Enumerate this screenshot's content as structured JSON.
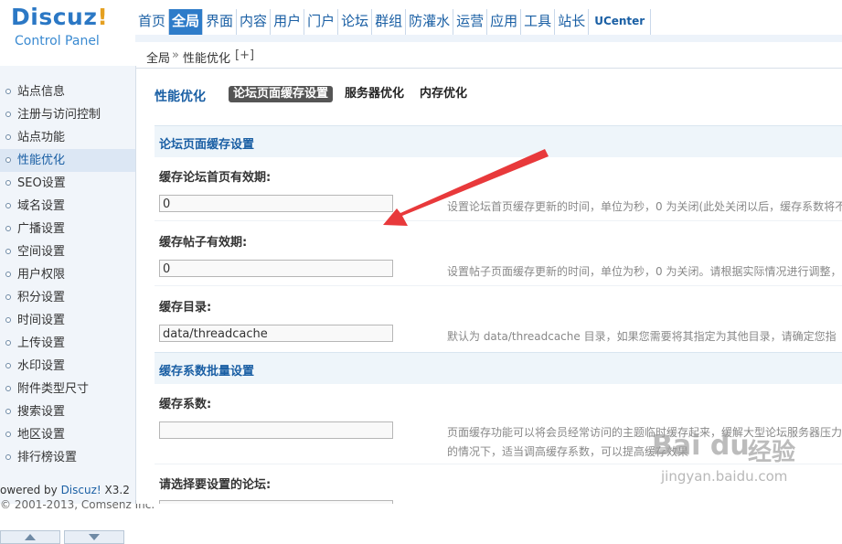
{
  "logo": {
    "brand": "Discuz",
    "brand_exclaim": "!",
    "sub": "Control Panel"
  },
  "topnav": {
    "items": [
      "首页",
      "全局",
      "界面",
      "内容",
      "用户",
      "门户",
      "论坛",
      "群组",
      "防灌水",
      "运营",
      "应用",
      "工具",
      "站长",
      "UCenter"
    ],
    "active": "全局"
  },
  "breadcrumb": {
    "root": "全局",
    "sep": "»",
    "current": "性能优化",
    "add": "[+]"
  },
  "sidebar": {
    "items": [
      "站点信息",
      "注册与访问控制",
      "站点功能",
      "性能优化",
      "SEO设置",
      "域名设置",
      "广播设置",
      "空间设置",
      "用户权限",
      "积分设置",
      "时间设置",
      "上传设置",
      "水印设置",
      "附件类型尺寸",
      "搜索设置",
      "地区设置",
      "排行榜设置"
    ],
    "active": "性能优化"
  },
  "footer": {
    "powered_prefix": "owered by ",
    "powered_brand": "Discuz!",
    "version": " X3.2",
    "copyright": "© 2001-2013, Comsenz Inc."
  },
  "main": {
    "title": "性能优化",
    "tabs": [
      "论坛页面缓存设置",
      "服务器优化",
      "内存优化"
    ],
    "active_tab": "论坛页面缓存设置",
    "section1": "论坛页面缓存设置",
    "fields": [
      {
        "label": "缓存论坛首页有效期:",
        "value": "0",
        "desc": "设置论坛首页缓存更新的时间，单位为秒，0 为关闭(此处关闭以后，缓存系数将不"
      },
      {
        "label": "缓存帖子有效期:",
        "value": "0",
        "desc": "设置帖子页面缓存更新的时间，单位为秒，0 为关闭。请根据实际情况进行调整，"
      },
      {
        "label": "缓存目录:",
        "value": "data/threadcache",
        "desc": "默认为 data/threadcache 目录，如果您需要将其指定为其他目录，请确定您指"
      }
    ],
    "section2": "缓存系数批量设置",
    "coef": {
      "label": "缓存系数:",
      "value": "",
      "desc_line1": "页面缓存功能可以将会员经常访问的主题临时缓存起来，缓解大型论坛服务器压力",
      "desc_line2": "的情况下，适当调高缓存系数，可以提高缓存效果"
    },
    "forum_select_label": "请选择要设置的论坛:"
  },
  "watermark": {
    "brand": "Bai du",
    "brand2": "经验",
    "url": "jingyan.baidu.com"
  },
  "colors": {
    "accent": "#2e7cc9",
    "arrow": "#e8393b",
    "link": "#1a5fa4"
  }
}
